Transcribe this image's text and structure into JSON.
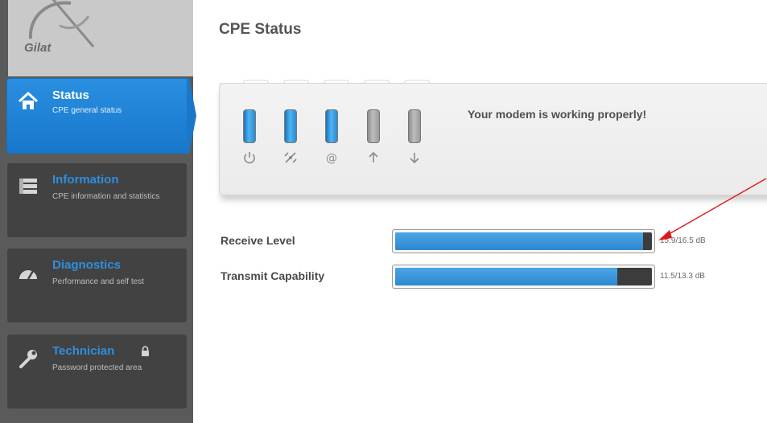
{
  "logo": {
    "text": "Gilat"
  },
  "sidebar": {
    "items": [
      {
        "title": "Status",
        "subtitle": "CPE general status",
        "icon": "home-icon",
        "active": true
      },
      {
        "title": "Information",
        "subtitle": "CPE information and statistics",
        "icon": "list-icon",
        "active": false
      },
      {
        "title": "Diagnostics",
        "subtitle": "Performance and self test",
        "icon": "gauge-icon",
        "active": false
      },
      {
        "title": "Technician",
        "subtitle": "Password protected area",
        "icon": "wrench-icon",
        "active": false,
        "locked": true
      }
    ]
  },
  "page": {
    "title": "CPE Status"
  },
  "modem": {
    "message": "Your modem is working properly!",
    "leds": [
      {
        "name": "power",
        "icon": "power-icon",
        "state": "on"
      },
      {
        "name": "satellite",
        "icon": "satellite-icon",
        "state": "on"
      },
      {
        "name": "internet",
        "icon": "at-icon",
        "state": "on"
      },
      {
        "name": "transmit",
        "icon": "arrow-up-icon",
        "state": "off"
      },
      {
        "name": "receive",
        "icon": "arrow-down-icon",
        "state": "off"
      }
    ]
  },
  "meters": [
    {
      "label": "Receive Level",
      "value": "15.9/16.5 dB",
      "fraction": 0.964
    },
    {
      "label": "Transmit Capability",
      "value": "11.5/13.3 dB",
      "fraction": 0.865
    }
  ],
  "colors": {
    "accent": "#1777cc",
    "sidebar": "#5a5a5a",
    "annotation_arrow": "#e0181b"
  }
}
